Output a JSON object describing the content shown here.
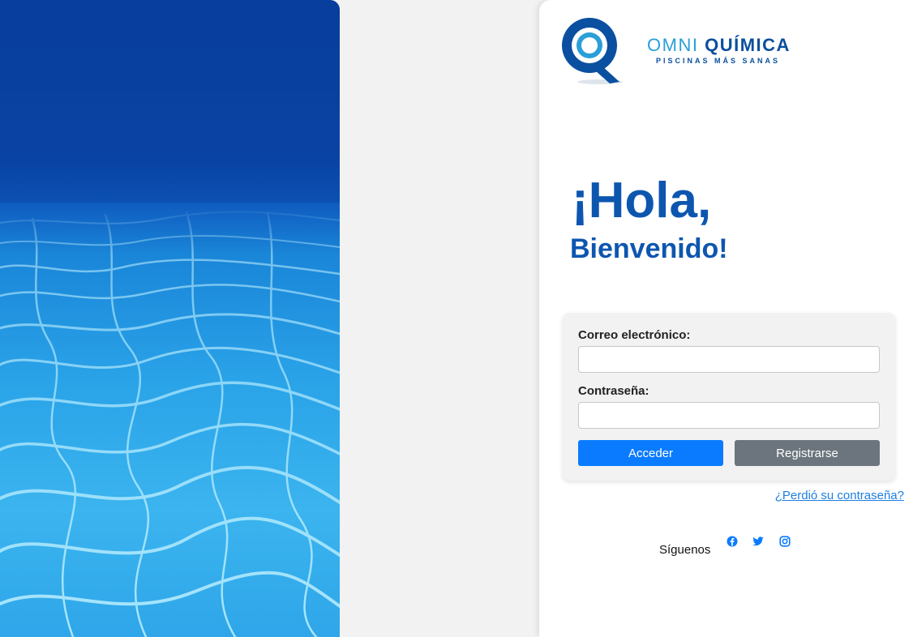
{
  "brand": {
    "name_light": "OMNI",
    "name_bold": "QUÍMICA",
    "tagline": "PISCINAS MÁS SANAS",
    "primary_color": "#0d56b0",
    "accent_color": "#2a9fd8"
  },
  "greeting": {
    "line1": "¡Hola,",
    "line2": "Bienvenido!"
  },
  "login_form": {
    "email_label": "Correo electrónico:",
    "email_value": "",
    "password_label": "Contraseña:",
    "password_value": "",
    "login_button": "Acceder",
    "register_button": "Registrarse"
  },
  "forgot_password_link": "¿Perdió su contraseña?",
  "social": {
    "label": "Síguenos",
    "icons": [
      "facebook-icon",
      "twitter-icon",
      "instagram-icon"
    ],
    "icon_color": "#0a7bff"
  }
}
